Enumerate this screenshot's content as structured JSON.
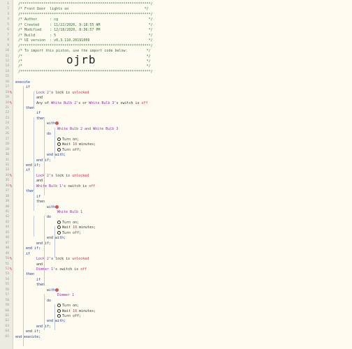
{
  "header": {
    "lines": [
      "/**************************************************************/",
      "/* Front Door  lights on                                    */",
      "/**************************************************************/",
      "/* Author      : cg                                           */",
      "/* Created     : 11/22/2020, 9:18:55 AM                       */",
      "/* Modified    : 12/18/2020, 8:36:57 PM                       */",
      "/* Build       : 5                                            */",
      "/* UI version  : v0.3.110.20191009                            */",
      "/**************************************************************/",
      "/* To import this piston, use the import code below:         */",
      "/*                                                           */",
      "/*                                                           */",
      "/*                                                           */",
      "/**************************************************************/"
    ],
    "import_code": "ojrb"
  },
  "code": {
    "execute": "execute",
    "if": "if",
    "and": "and",
    "then": "then",
    "with": "with",
    "do": "do",
    "end_with": "end with;",
    "end_if": "end if;",
    "end_execute": "end execute;",
    "lock": "Lock 2",
    "lock_attr": "'s lock is",
    "unlocked": "unlocked",
    "any_of": "Any of",
    "wb2": "White Bulb 2",
    "or": "'s or",
    "wb3": "White Bulb 3",
    "switch_is": "'s switch is",
    "off": "off",
    "wb2_and_wb3": "White Bulb 2 and White Bulb 3",
    "turn_on": "Turn on;",
    "wait": "Wait",
    "ten": "10",
    "minutes": "minutes;",
    "turn_off": "Turn off;",
    "wb1": "White Bulb 1",
    "dimmer": "Dimmer 1"
  },
  "line_numbers": [
    "1",
    "2",
    "3",
    "4",
    "5",
    "6",
    "7",
    "8",
    "9",
    "10",
    "11",
    "12",
    "13",
    "14",
    "15",
    "16",
    "17",
    "18",
    "19",
    "20",
    "21",
    "22",
    "23",
    "24",
    "25",
    "26",
    "27",
    "28",
    "29",
    "30",
    "31",
    "32",
    "33",
    "34",
    "35",
    "36",
    "37",
    "38",
    "39",
    "40",
    "41",
    "42",
    "43",
    "44",
    "45",
    "46",
    "47",
    "48",
    "49",
    "50",
    "51",
    "52",
    "53",
    "54",
    "55",
    "56",
    "57",
    "58",
    "59",
    "60",
    "61",
    "62",
    "63",
    "64",
    "65",
    "66"
  ],
  "marker": "%"
}
